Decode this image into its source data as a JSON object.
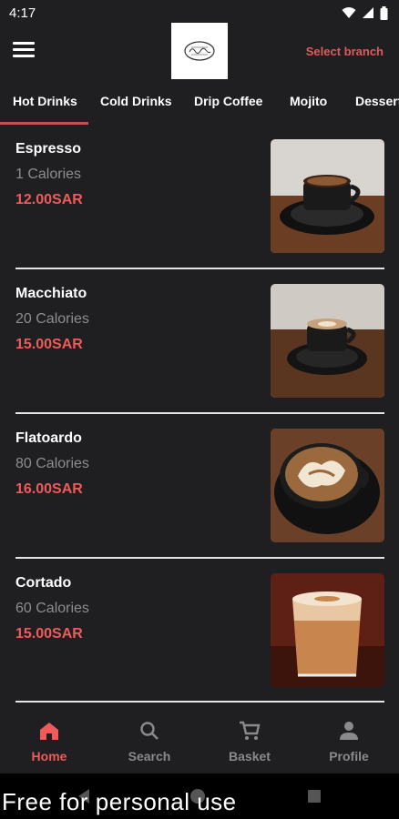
{
  "status": {
    "time": "4:17"
  },
  "header": {
    "select_branch": "Select branch"
  },
  "tabs": [
    {
      "label": "Hot Drinks",
      "active": true
    },
    {
      "label": "Cold Drinks"
    },
    {
      "label": "Drip Coffee"
    },
    {
      "label": "Mojito"
    },
    {
      "label": "Desserts"
    }
  ],
  "products": [
    {
      "name": "Espresso",
      "calories": "1 Calories",
      "price": "12.00SAR"
    },
    {
      "name": "Macchiato",
      "calories": "20 Calories",
      "price": "15.00SAR"
    },
    {
      "name": "Flatoardo",
      "calories": "80 Calories",
      "price": "16.00SAR"
    },
    {
      "name": "Cortado",
      "calories": "60 Calories",
      "price": "15.00SAR"
    }
  ],
  "bottom_nav": [
    {
      "label": "Home",
      "icon": "home-icon",
      "active": true
    },
    {
      "label": "Search",
      "icon": "search-icon"
    },
    {
      "label": "Basket",
      "icon": "cart-icon"
    },
    {
      "label": "Profile",
      "icon": "person-icon"
    }
  ],
  "watermark": "Free for personal use",
  "colors": {
    "accent": "#ef5a5a",
    "background": "#1f1f22",
    "divider": "#e5e5e5"
  }
}
